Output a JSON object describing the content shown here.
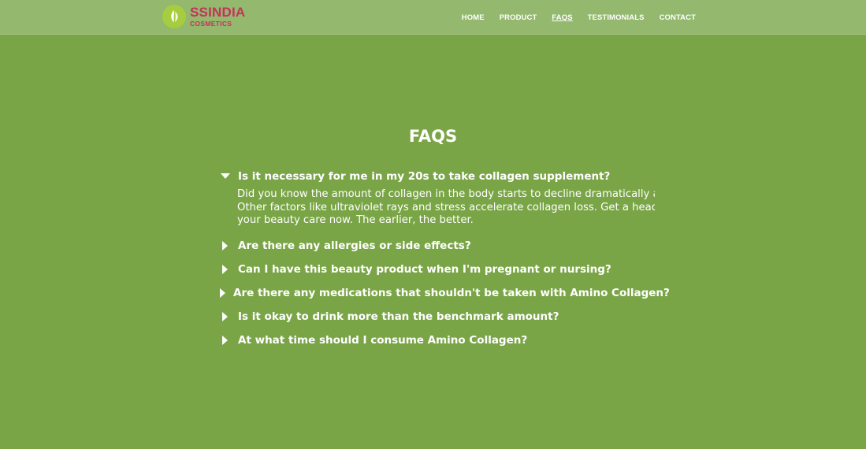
{
  "brand": {
    "name": "SSINDIA",
    "subtitle": "COSMETICS",
    "color": "#c8315c",
    "mark_color": "#a6cc3f"
  },
  "nav": {
    "items": [
      {
        "label": "HOME",
        "active": false
      },
      {
        "label": "PRODUCT",
        "active": false
      },
      {
        "label": "FAQS",
        "active": true
      },
      {
        "label": "TESTIMONIALS",
        "active": false
      },
      {
        "label": "CONTACT",
        "active": false
      }
    ]
  },
  "page": {
    "title": "FAQS",
    "background": "#7aa547",
    "navbar_background": "#93b86e"
  },
  "faqs": [
    {
      "question": "Is it necessary for me in my 20s to take collagen supplement?",
      "expanded": true,
      "answer_lines": [
        "Did you know the amount of collagen in the body starts to decline dramatically after",
        "Other factors like ultraviolet rays and stress accelerate collagen loss. Get a head start",
        "your beauty care now. The earlier, the better."
      ]
    },
    {
      "question": "Are there any allergies or side effects?",
      "expanded": false
    },
    {
      "question": "Can I have this beauty product when I'm pregnant or nursing?",
      "expanded": false
    },
    {
      "question": "Are there any medications that shouldn't be taken with Amino Collagen?",
      "expanded": false
    },
    {
      "question": "Is it okay to drink more than the benchmark amount?",
      "expanded": false
    },
    {
      "question": "At what time should I consume Amino Collagen?",
      "expanded": false
    }
  ]
}
